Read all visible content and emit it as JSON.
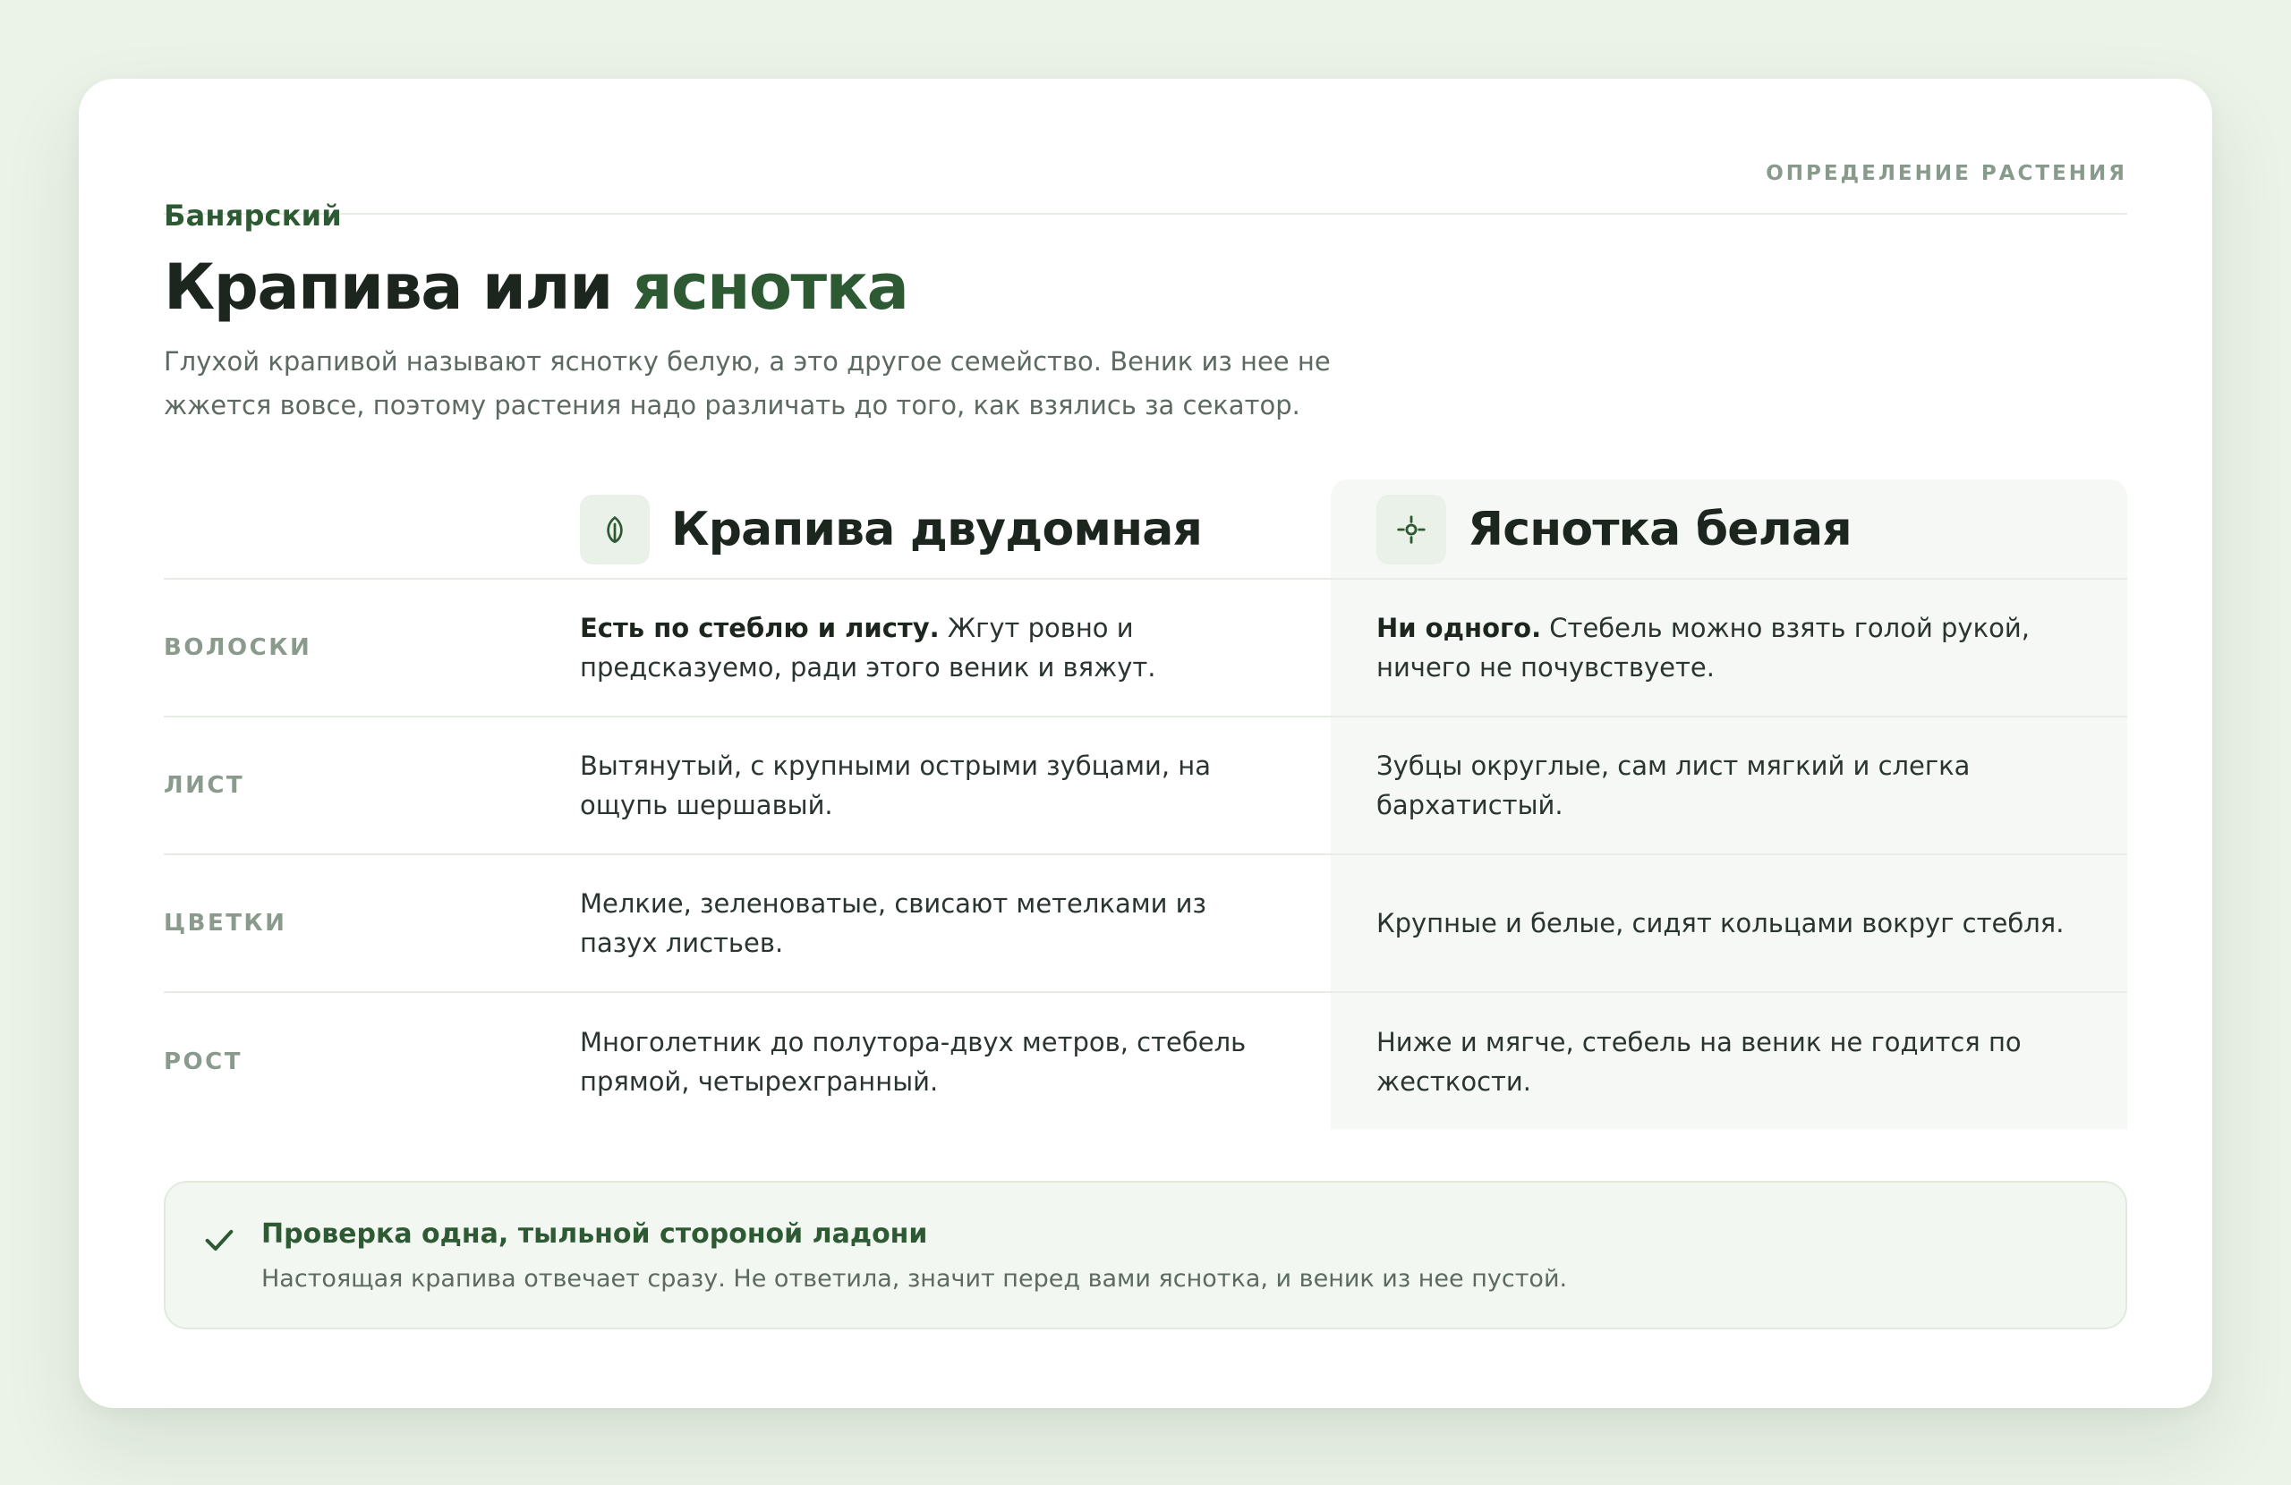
{
  "header": {
    "brand": "Банярский",
    "section": "ОПРЕДЕЛЕНИЕ РАСТЕНИЯ"
  },
  "hero": {
    "title_main": "Крапива или ",
    "title_accent": "яснотка",
    "subtitle": "Глухой крапивой называют яснотку белую, а это другое семейство. Веник из нее не жжется вовсе, поэтому растения надо различать до того, как взялись за секатор."
  },
  "comparison": {
    "columns": [
      {
        "name": "Крапива двудомная",
        "icon": "leaf-icon"
      },
      {
        "name": "Яснотка белая",
        "icon": "flower-icon"
      }
    ],
    "rows": [
      {
        "label": "ВОЛОСКИ",
        "a_bold": "Есть по стеблю и листу.",
        "a_text": " Жгут ровно и предсказуемо, ради этого веник и вяжут.",
        "b_bold": "Ни одного.",
        "b_text": " Стебель можно взять голой рукой, ничего не почувствуете."
      },
      {
        "label": "ЛИСТ",
        "a_text": "Вытянутый, с крупными острыми зубцами, на ощупь шершавый.",
        "b_text": "Зубцы округлые, сам лист мягкий и слегка бархатистый."
      },
      {
        "label": "ЦВЕТКИ",
        "a_text": "Мелкие, зеленоватые, свисают метелками из пазух листьев.",
        "b_text": "Крупные и белые, сидят кольцами вокруг стебля."
      },
      {
        "label": "РОСТ",
        "a_text": "Многолетник до полутора-двух метров, стебель прямой, четырехгранный.",
        "b_text": "Ниже и мягче, стебель на веник не годится по жесткости."
      }
    ]
  },
  "note": {
    "icon": "check-icon",
    "title": "Проверка одна, тыльной стороной ладони",
    "text": "Настоящая крапива отвечает сразу. Не ответила, значит перед вами яснотка, и веник из нее пустой."
  },
  "colors": {
    "accent": "#2d5a33",
    "background": "#ebf2e8",
    "card": "#ffffff",
    "muted": "#889a8b"
  }
}
